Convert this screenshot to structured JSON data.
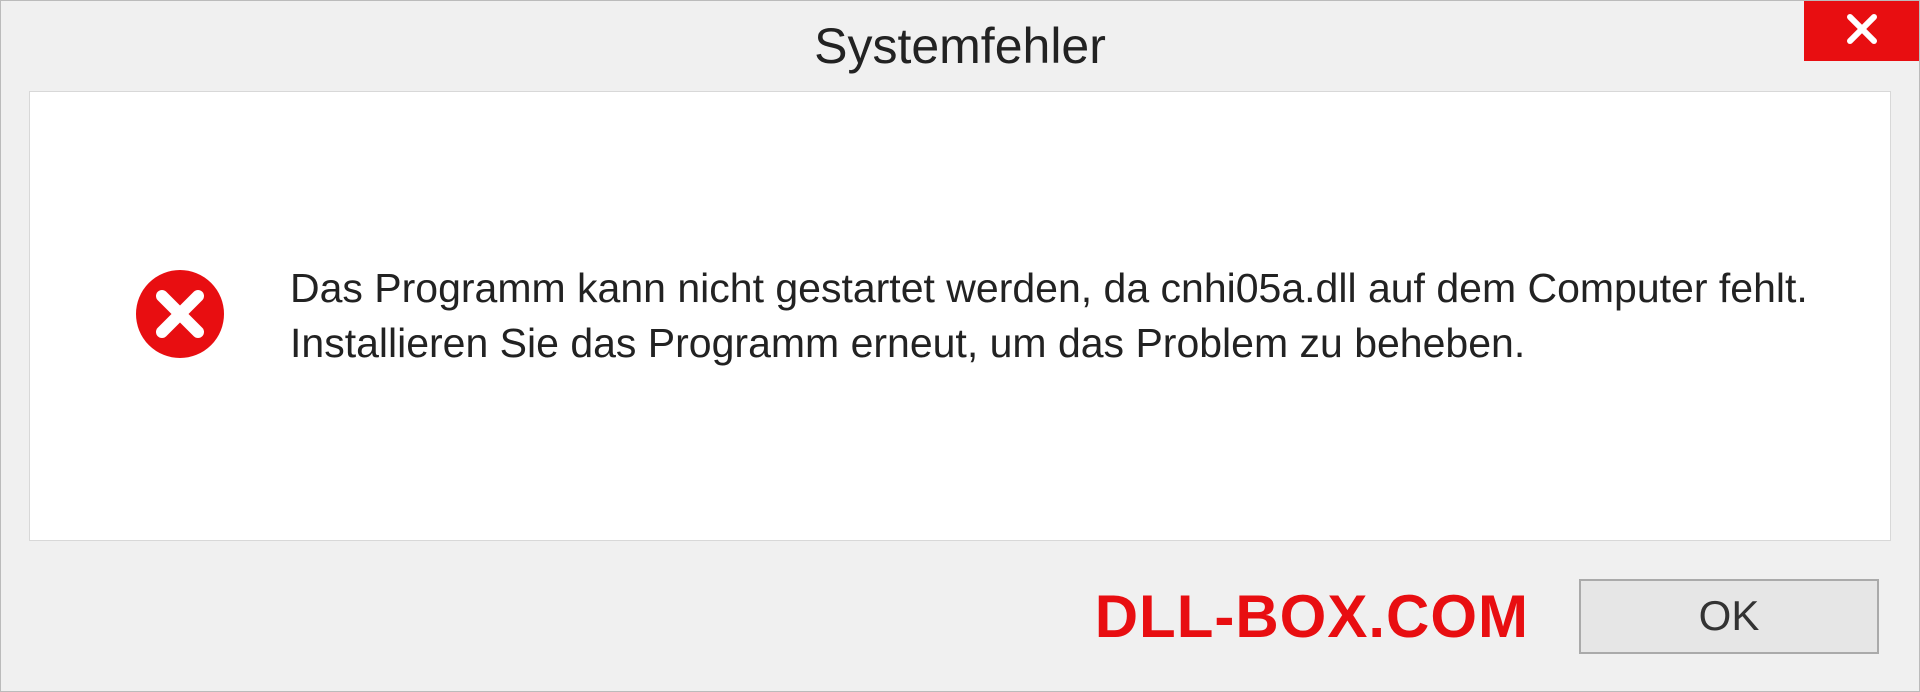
{
  "dialog": {
    "title": "Systemfehler",
    "message": "Das Programm kann nicht gestartet werden, da cnhi05a.dll auf dem Computer fehlt. Installieren Sie das Programm erneut, um das Problem zu beheben.",
    "ok_label": "OK"
  },
  "watermark": "DLL-BOX.COM",
  "colors": {
    "error_red": "#e80e11",
    "background": "#f0f0f0",
    "content_bg": "#ffffff"
  }
}
